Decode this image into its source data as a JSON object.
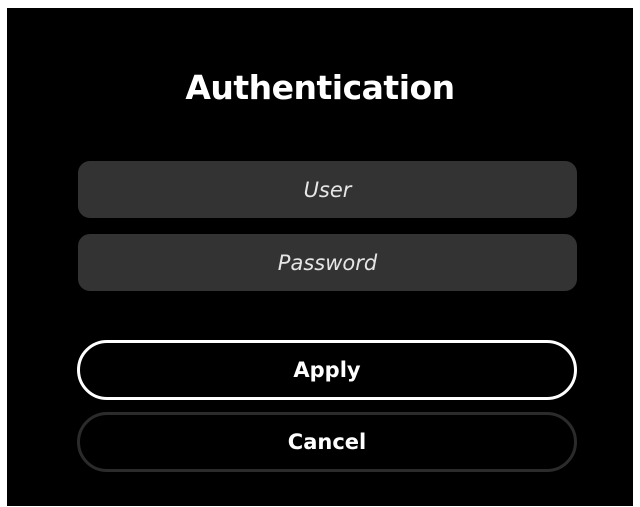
{
  "dialog": {
    "title": "Authentication",
    "user_field": {
      "placeholder": "User",
      "value": ""
    },
    "password_field": {
      "placeholder": "Password",
      "value": ""
    },
    "apply_label": "Apply",
    "cancel_label": "Cancel"
  },
  "colors": {
    "background": "#000000",
    "field_background": "#333333",
    "text": "#ffffff",
    "apply_border": "#ffffff",
    "cancel_border": "#2b2b2b"
  }
}
